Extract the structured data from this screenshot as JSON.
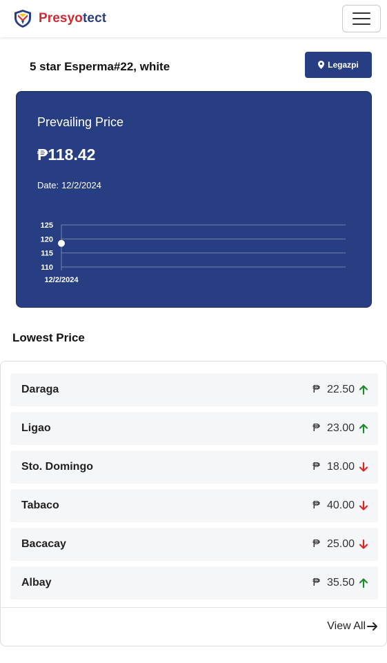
{
  "brand": {
    "name_part1": "Presyo",
    "name_part2": "tect"
  },
  "product": {
    "name": "5 star Esperma#22, white"
  },
  "location_button": {
    "label": "Legazpi",
    "icon": "map-pin-icon"
  },
  "prevailing": {
    "title": "Prevailing Price",
    "price": "₱118.42",
    "date_label": "Date:",
    "date_value": "12/2/2024"
  },
  "chart_data": {
    "type": "line",
    "x": [
      "12/2/2024"
    ],
    "series": [
      {
        "values": [
          118.42
        ]
      }
    ],
    "y_ticks": [
      110,
      115,
      120,
      125
    ],
    "ylim": [
      110,
      125
    ],
    "grid": true,
    "title": "",
    "xlabel": "",
    "ylabel": ""
  },
  "lowest": {
    "title": "Lowest Price",
    "currency": "₱",
    "items": [
      {
        "location": "Daraga",
        "price": "22.50",
        "trend": "up"
      },
      {
        "location": "Ligao",
        "price": "23.00",
        "trend": "up"
      },
      {
        "location": "Sto. Domingo",
        "price": "18.00",
        "trend": "down"
      },
      {
        "location": "Tabaco",
        "price": "40.00",
        "trend": "down"
      },
      {
        "location": "Bacacay",
        "price": "25.00",
        "trend": "down"
      },
      {
        "location": "Albay",
        "price": "35.50",
        "trend": "up"
      }
    ],
    "view_all": "View All"
  },
  "colors": {
    "brand_red": "#d42a2f",
    "brand_navy": "#283e82",
    "up": "#1e8a2e",
    "down": "#e02424"
  }
}
